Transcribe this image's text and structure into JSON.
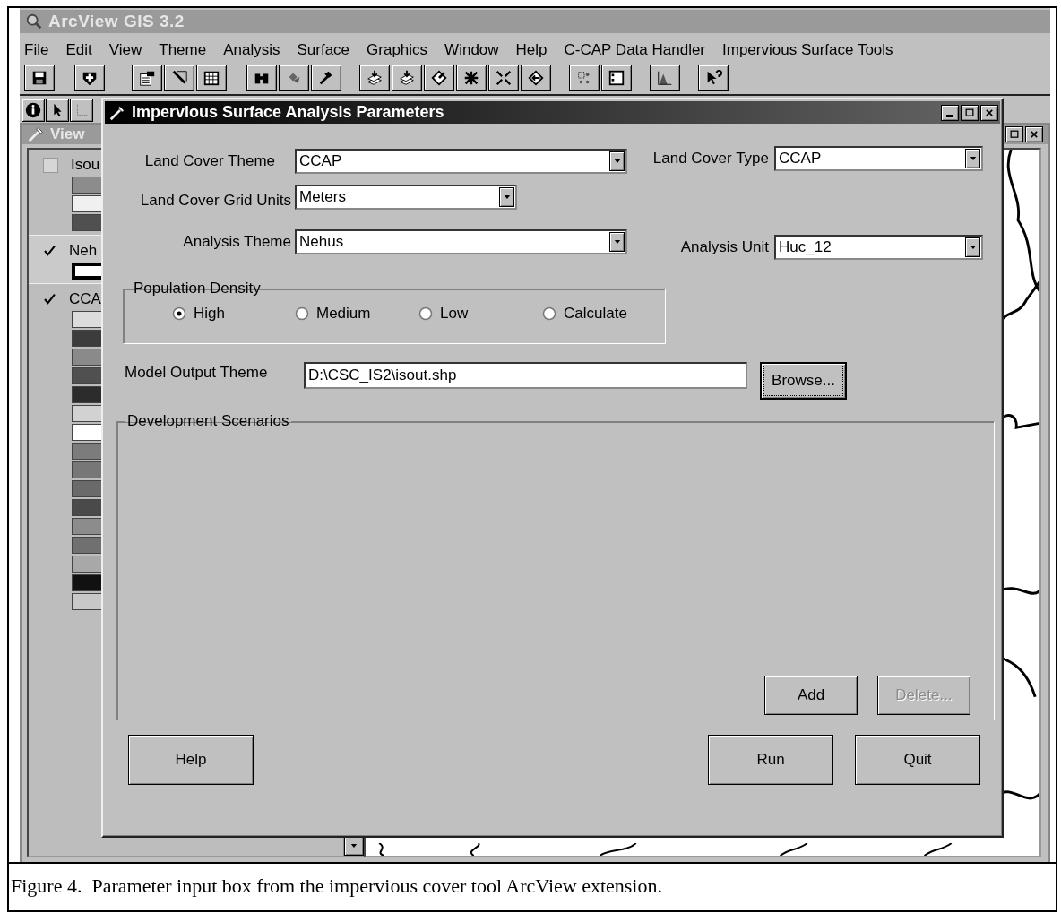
{
  "app": {
    "title": "ArcView GIS 3.2",
    "menu": [
      "File",
      "Edit",
      "View",
      "Theme",
      "Analysis",
      "Surface",
      "Graphics",
      "Window",
      "Help",
      "C-CAP Data Handler",
      "Impervious Surface Tools"
    ]
  },
  "view_window": {
    "title": "View",
    "legend": [
      {
        "name": "Isou",
        "checked": false,
        "selected": false,
        "swatches": [
          {
            "kind": "fill",
            "color": "#8c8c8c"
          },
          {
            "kind": "fill",
            "color": "#f0f0f0"
          },
          {
            "kind": "fill",
            "color": "#505050"
          }
        ]
      },
      {
        "name": "Neh",
        "checked": true,
        "selected": true,
        "swatches": [
          {
            "kind": "outline",
            "color": "#ffffff"
          }
        ]
      },
      {
        "name": "CCA",
        "checked": true,
        "selected": false,
        "swatches": [
          {
            "kind": "fill",
            "color": "#dcdcdc"
          },
          {
            "kind": "fill",
            "color": "#3c3c3c"
          },
          {
            "kind": "fill",
            "color": "#8a8a8a"
          },
          {
            "kind": "fill",
            "color": "#505050"
          },
          {
            "kind": "fill",
            "color": "#2c2c2c"
          },
          {
            "kind": "fill",
            "color": "#d2d2d2"
          },
          {
            "kind": "fill",
            "color": "#ffffff"
          },
          {
            "kind": "fill",
            "color": "#7c7c7c"
          },
          {
            "kind": "fill",
            "color": "#777777"
          },
          {
            "kind": "fill",
            "color": "#6a6a6a"
          },
          {
            "kind": "fill",
            "color": "#4a4a4a"
          },
          {
            "kind": "fill",
            "color": "#8c8c8c"
          },
          {
            "kind": "fill",
            "color": "#707070"
          },
          {
            "kind": "fill",
            "color": "#a8a8a8"
          },
          {
            "kind": "fill",
            "color": "#111111"
          },
          {
            "kind": "fill",
            "color": "#c8c8c8"
          }
        ]
      }
    ]
  },
  "dialog": {
    "title": "Impervious Surface Analysis Parameters",
    "land_cover_theme": {
      "label": "Land Cover Theme",
      "value": "CCAP"
    },
    "land_cover_type": {
      "label": "Land Cover Type",
      "value": "CCAP"
    },
    "land_cover_grid_units": {
      "label": "Land Cover Grid Units",
      "value": "Meters"
    },
    "analysis_theme": {
      "label": "Analysis Theme",
      "value": "Nehus"
    },
    "analysis_unit": {
      "label": "Analysis Unit",
      "value": "Huc_12"
    },
    "population_density": {
      "label": "Population Density",
      "options": [
        {
          "label": "High",
          "selected": true
        },
        {
          "label": "Medium",
          "selected": false
        },
        {
          "label": "Low",
          "selected": false
        },
        {
          "label": "Calculate",
          "selected": false
        }
      ]
    },
    "model_output_theme": {
      "label": "Model Output Theme",
      "value": "D:\\CSC_IS2\\isout.shp",
      "button": "Browse..."
    },
    "development_scenarios": {
      "label": "Development Scenarios",
      "buttons": [
        {
          "label": "Add",
          "disabled": false
        },
        {
          "label": "Delete...",
          "disabled": true
        }
      ]
    },
    "footer_buttons": [
      "Help",
      "Run",
      "Quit"
    ]
  },
  "caption": "Figure 4.  Parameter input box from the impervious cover tool ArcView extension."
}
